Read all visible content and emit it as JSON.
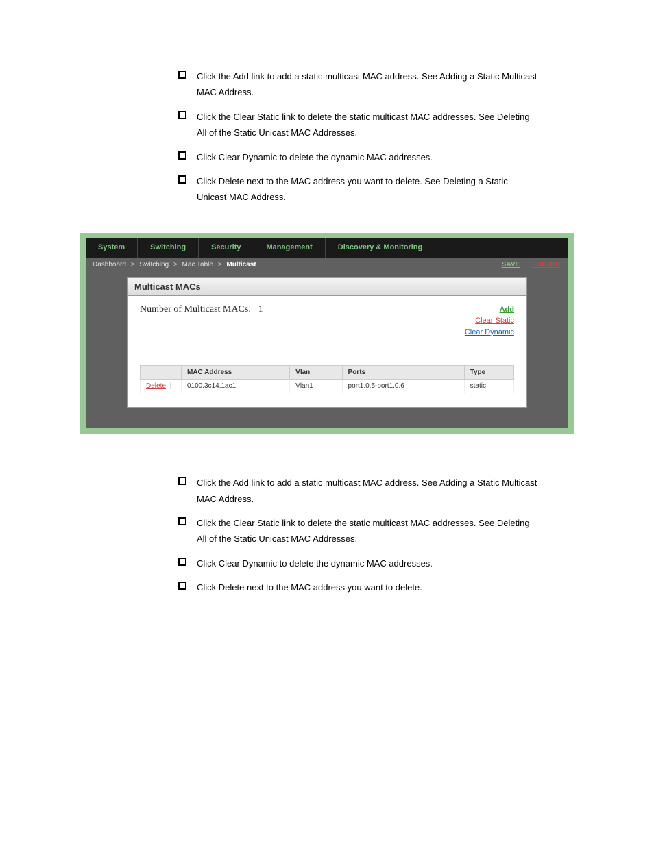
{
  "doc": {
    "bullets_top": [
      "Click the Add link to add a static multicast MAC address. See Adding a Static Multicast MAC Address.",
      "Click the Clear Static link to delete the static multicast MAC addresses. See Deleting All of the Static Unicast MAC Addresses.",
      "Click Clear Dynamic to delete the dynamic MAC addresses.",
      "Click Delete next to the MAC address you want to delete. See Deleting a Static Unicast MAC Address."
    ],
    "bullets_bottom": [
      "Click the Add link to add a static multicast MAC address. See Adding a Static Multicast MAC Address.",
      "Click the Clear Static link to delete the static multicast MAC addresses. See Deleting All of the Static Unicast MAC Addresses.",
      "Click Clear Dynamic to delete the dynamic MAC addresses.",
      "Click Delete next to the MAC address you want to delete."
    ]
  },
  "ui": {
    "nav": [
      "System",
      "Switching",
      "Security",
      "Management",
      "Discovery & Monitoring"
    ],
    "breadcrumb": {
      "parts": [
        "Dashboard",
        "Switching",
        "Mac Table"
      ],
      "current": "Multicast"
    },
    "top_actions": {
      "save": "SAVE",
      "logout": "LOGOUT"
    },
    "panel": {
      "title": "Multicast MACs",
      "count_label": "Number of Multicast MACs:",
      "count_value": "1",
      "actions": {
        "add": "Add",
        "clear_static": "Clear Static",
        "clear_dynamic": "Clear Dynamic"
      },
      "table": {
        "headers": [
          "MAC Address",
          "Vlan",
          "Ports",
          "Type"
        ],
        "rows": [
          {
            "action": "Delete",
            "mac": "0100.3c14.1ac1",
            "vlan": "Vlan1",
            "ports": "port1.0.5-port1.0.6",
            "type": "static"
          }
        ]
      }
    }
  }
}
